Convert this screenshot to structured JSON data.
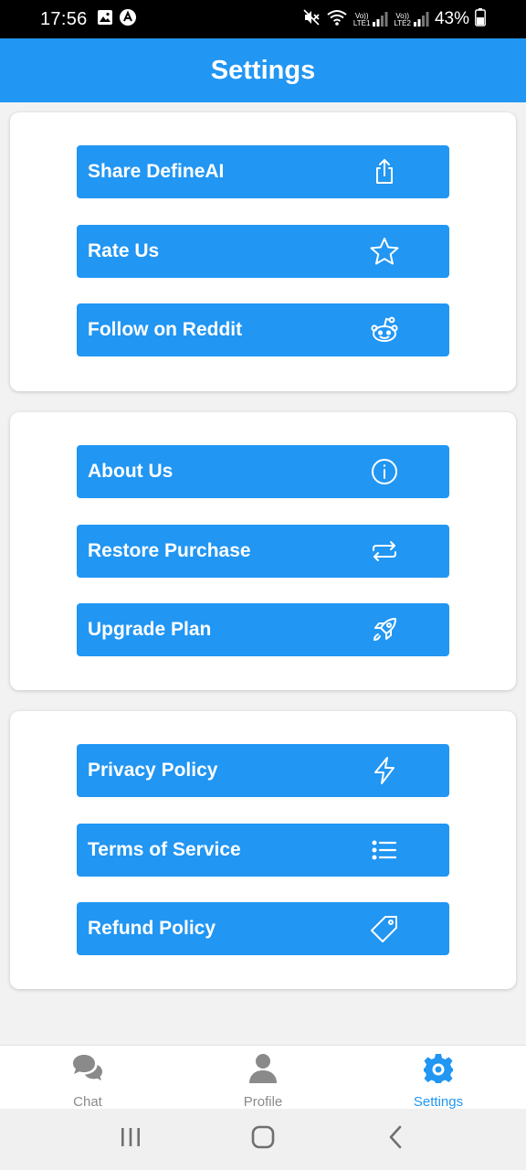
{
  "status_bar": {
    "time": "17:56",
    "battery_percent": "43%",
    "sim1_label": "LTE1",
    "sim2_label": "LTE2"
  },
  "header": {
    "title": "Settings"
  },
  "sections": [
    {
      "items": [
        {
          "label": "Share DefineAI",
          "icon": "share-icon"
        },
        {
          "label": "Rate Us",
          "icon": "star-icon"
        },
        {
          "label": "Follow on Reddit",
          "icon": "reddit-icon"
        }
      ]
    },
    {
      "items": [
        {
          "label": "About Us",
          "icon": "info-icon"
        },
        {
          "label": "Restore Purchase",
          "icon": "repeat-icon"
        },
        {
          "label": "Upgrade Plan",
          "icon": "rocket-icon"
        }
      ]
    },
    {
      "items": [
        {
          "label": "Privacy Policy",
          "icon": "lightning-icon"
        },
        {
          "label": "Terms of Service",
          "icon": "list-icon"
        },
        {
          "label": "Refund Policy",
          "icon": "tag-icon"
        }
      ]
    }
  ],
  "bottom_nav": {
    "items": [
      {
        "label": "Chat",
        "icon": "chat-bubbles-icon",
        "active": false
      },
      {
        "label": "Profile",
        "icon": "person-icon",
        "active": false
      },
      {
        "label": "Settings",
        "icon": "gear-icon",
        "active": true
      }
    ]
  },
  "colors": {
    "primary": "#2196f3",
    "background": "#f2f2f2",
    "inactive_nav": "#8a8a8a"
  }
}
